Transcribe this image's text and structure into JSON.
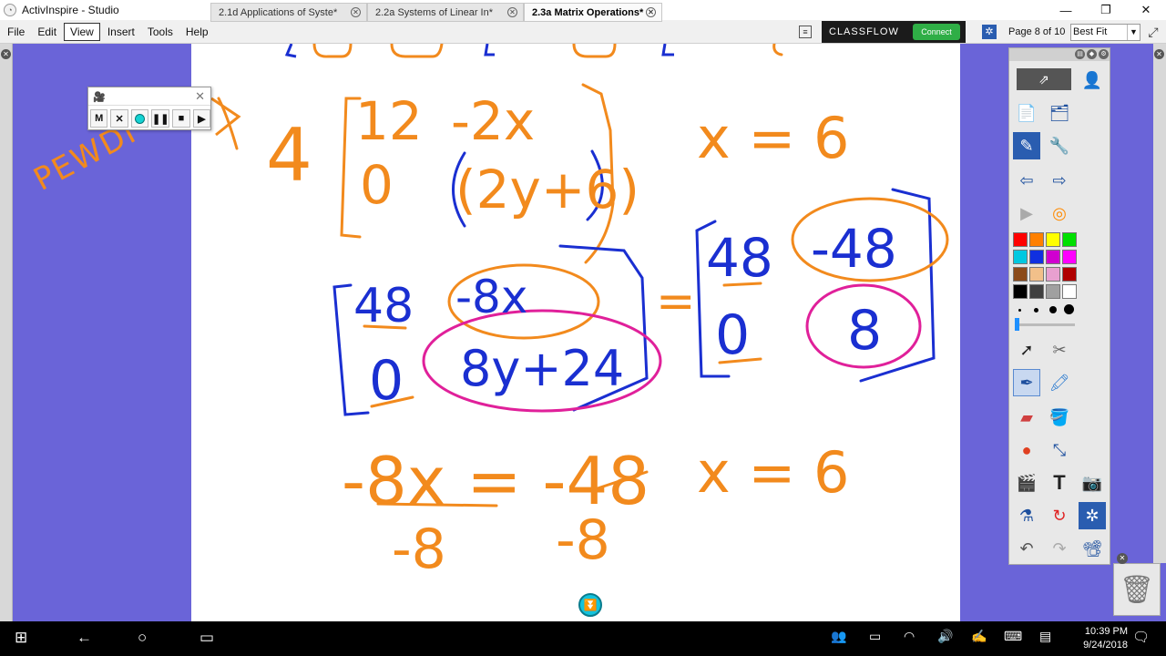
{
  "window": {
    "title": "ActivInspire - Studio"
  },
  "menu": [
    "File",
    "Edit",
    "View",
    "Insert",
    "Tools",
    "Help"
  ],
  "active_menu": "View",
  "tabs": [
    {
      "label": "2.1d Applications of Syste*"
    },
    {
      "label": "2.2a Systems of Linear In*"
    },
    {
      "label": "2.3a Matrix Operations*",
      "active": true
    }
  ],
  "classflow": {
    "brand": "CLASSFLOW",
    "button": "Connect"
  },
  "page_indicator": "Page 8 of 10",
  "zoom": "Best Fit",
  "recorder": {
    "buttons": [
      "M",
      "✕",
      "●",
      "❚❚",
      "■",
      "▶"
    ]
  },
  "annotation_side": "PEWDI",
  "board": {
    "row1_scalar": "4",
    "row1_matrix": [
      "12",
      "-2x",
      "0",
      "(2y+6)"
    ],
    "row1_solution": "x = 6",
    "left_matrix": [
      "48",
      "-8x",
      "0",
      "8y+24"
    ],
    "equals": "=",
    "right_matrix": [
      "48",
      "-48",
      "0",
      "8"
    ],
    "equation": "-8x = -48",
    "divisors": [
      "-8",
      "-8"
    ],
    "equation_solution": "x = 6"
  },
  "colors": {
    "orange": "#f28a1d",
    "blue": "#1a2fd1",
    "magenta": "#e0209a",
    "background": "#6a64d8"
  },
  "palette": [
    "#ff0000",
    "#ff8000",
    "#ffff00",
    "#00e000",
    "#00c8e0",
    "#1030e0",
    "#d000d0",
    "#ff00ff",
    "#8b4a1a",
    "#f2c08a",
    "#e8a0d0",
    "#b00000",
    "#000000",
    "#404040",
    "#a0a0a0",
    "#ffffff"
  ],
  "taskbar": {
    "time": "10:39 PM",
    "date": "9/24/2018"
  }
}
